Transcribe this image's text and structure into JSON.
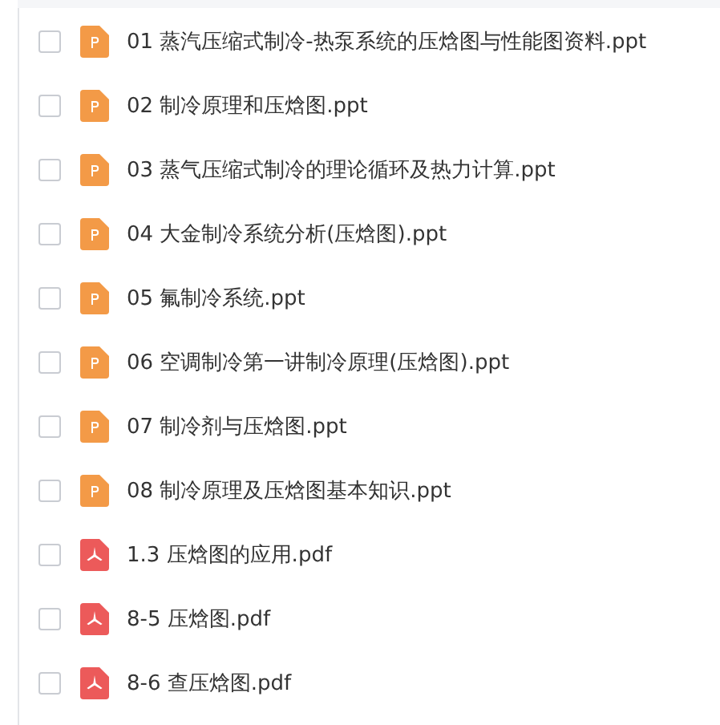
{
  "files": [
    {
      "kind": "ppt",
      "name": "01 蒸汽压缩式制冷-热泵系统的压焓图与性能图资料.ppt",
      "checked": false
    },
    {
      "kind": "ppt",
      "name": "02 制冷原理和压焓图.ppt",
      "checked": false
    },
    {
      "kind": "ppt",
      "name": "03 蒸气压缩式制冷的理论循环及热力计算.ppt",
      "checked": false
    },
    {
      "kind": "ppt",
      "name": "04 大金制冷系统分析(压焓图).ppt",
      "checked": false
    },
    {
      "kind": "ppt",
      "name": "05 氟制冷系统.ppt",
      "checked": false
    },
    {
      "kind": "ppt",
      "name": "06 空调制冷第一讲制冷原理(压焓图).ppt",
      "checked": false
    },
    {
      "kind": "ppt",
      "name": "07 制冷剂与压焓图.ppt",
      "checked": false
    },
    {
      "kind": "ppt",
      "name": "08 制冷原理及压焓图基本知识.ppt",
      "checked": false
    },
    {
      "kind": "pdf",
      "name": "1.3 压焓图的应用.pdf",
      "checked": false
    },
    {
      "kind": "pdf",
      "name": "8-5 压焓图.pdf",
      "checked": false
    },
    {
      "kind": "pdf",
      "name": "8-6 查压焓图.pdf",
      "checked": false
    }
  ]
}
